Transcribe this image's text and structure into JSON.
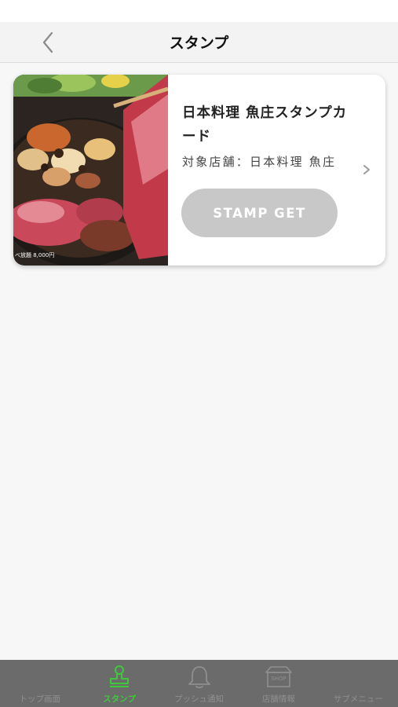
{
  "header": {
    "title": "スタンプ",
    "back_icon": "chevron-left-icon"
  },
  "card": {
    "title": "日本料理 魚庄スタンプカード",
    "shop": "対象店舗：日本料理 魚庄",
    "button_label": "STAMP GET",
    "photo_caption": "べ放題 8,000円",
    "photo_subject": "sukiyaki beef and vegetables in iron pot"
  },
  "tabs": [
    {
      "label": "トップ画面",
      "icon": "home-icon",
      "active": false
    },
    {
      "label": "スタンプ",
      "icon": "stamp-icon",
      "active": true
    },
    {
      "label": "プッシュ通知",
      "icon": "bell-icon",
      "active": false
    },
    {
      "label": "店舗情報",
      "icon": "shop-icon",
      "active": false,
      "icon_text": "SHOP"
    },
    {
      "label": "サブメニュー",
      "icon": "menu-icon",
      "active": false
    }
  ],
  "colors": {
    "accent": "#3ec83a",
    "tab_bar": "#6b6b6b",
    "button_disabled": "#c8c8c8"
  }
}
